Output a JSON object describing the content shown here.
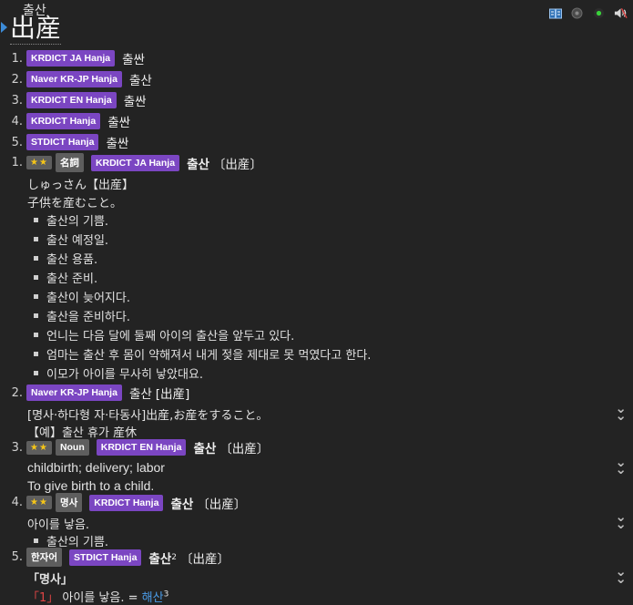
{
  "header": {
    "reading": "출산",
    "headword": "出産",
    "icons": [
      "book-icon",
      "circle-icon",
      "green-dot-icon",
      "speaker-icon"
    ]
  },
  "summary": [
    {
      "num": "1.",
      "tag": "KRDICT JA Hanja",
      "word": "출싼"
    },
    {
      "num": "2.",
      "tag": "Naver KR-JP Hanja",
      "word": "출산"
    },
    {
      "num": "3.",
      "tag": "KRDICT EN Hanja",
      "word": "출싼"
    },
    {
      "num": "4.",
      "tag": "KRDICT Hanja",
      "word": "출싼"
    },
    {
      "num": "5.",
      "tag": "STDICT Hanja",
      "word": "출싼"
    }
  ],
  "entry1": {
    "num": "1.",
    "stars": "★★",
    "pos": "名詞",
    "tag": "KRDICT JA Hanja",
    "word": "출산",
    "hanja": "〔出産〕",
    "reading": "しゅっさん【出産】",
    "definition": "子供を産むこと。",
    "examples": [
      "출산의 기쁨.",
      "출산 예정일.",
      "출산 용품.",
      "출산 준비.",
      "출산이 늦어지다.",
      "출산을 준비하다.",
      "언니는 다음 달에 둘째 아이의 출산을 앞두고 있다.",
      "엄마는 출산 후 몸이 약해져서 내게 젖을 제대로 못 먹였다고 한다.",
      "이모가 아이를 무사히 낳았대요."
    ]
  },
  "entry2": {
    "num": "2.",
    "tag": "Naver KR-JP Hanja",
    "word": "출산",
    "hanja": "[出産]",
    "line1": "[명사·하다형 자·타동사]出産,お産をすること。",
    "line2": "【예】출산 휴가 産休"
  },
  "entry3": {
    "num": "3.",
    "stars": "★★",
    "pos": "Noun",
    "tag": "KRDICT EN Hanja",
    "word": "출산",
    "hanja": "〔出産〕",
    "line1": "childbirth; delivery; labor",
    "line2": "To give birth to a child."
  },
  "entry4": {
    "num": "4.",
    "stars": "★★",
    "pos": "명사",
    "tag": "KRDICT Hanja",
    "word": "출산",
    "hanja": "〔出産〕",
    "line1": "아이를 낳음.",
    "example": "출산의 기쁨."
  },
  "entry5": {
    "num": "5.",
    "pos": "한자어",
    "tag": "STDICT Hanja",
    "word": "출산",
    "sup": "2",
    "hanja": "〔出産〕",
    "pos_label": "「명사」",
    "sense_num": "「1」",
    "definition": "아이를 낳음. = ",
    "link": "해산",
    "link_sup": "3"
  },
  "colors": {
    "tag": "#7b46c2",
    "grey_tag": "#5e5e5e",
    "link": "#4a9ce8",
    "arrow": "#3c8bd8"
  }
}
